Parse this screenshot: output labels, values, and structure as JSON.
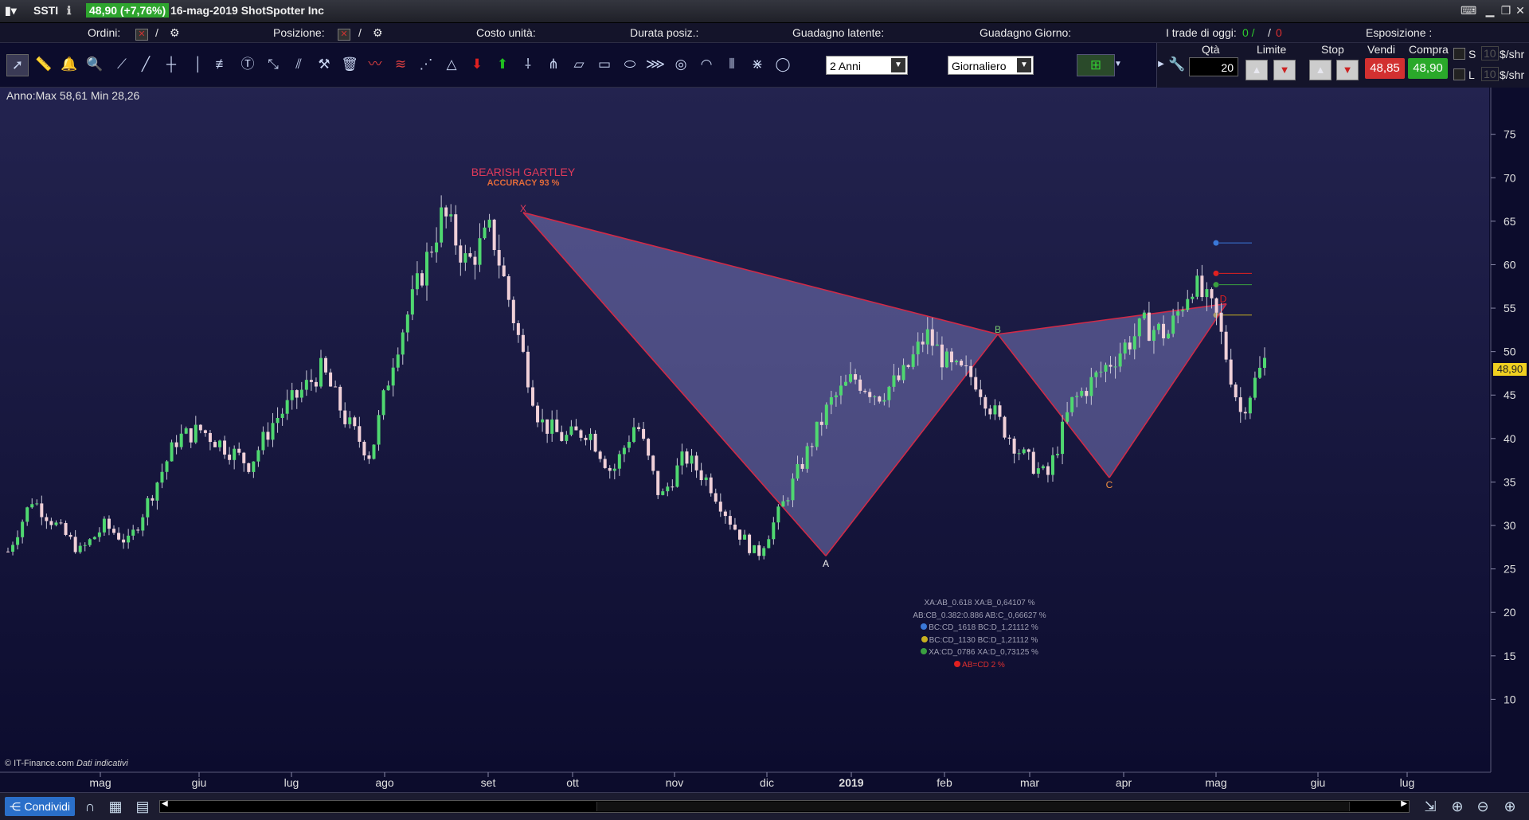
{
  "titlebar": {
    "symbol": "SSTI",
    "price_badge": "48,90 (+7,76%)",
    "date_title": "16-mag-2019 ShotSpotter Inc"
  },
  "infobar": {
    "orders_label": "Ordini:",
    "orders_sep": "/",
    "position_label": "Posizione:",
    "position_sep": "/",
    "unit_cost_label": "Costo unità:",
    "duration_label": "Durata posiz.:",
    "latent_gain_label": "Guadagno latente:",
    "day_gain_label": "Guadagno Giorno:",
    "trades_today_label": "I trade di oggi:",
    "trades_green": "0 /",
    "trades_sep": "/",
    "trades_red": "0",
    "exposure_label": "Esposizione :"
  },
  "toolbar": {
    "period_select": "2 Anni",
    "interval_select": "Giornaliero"
  },
  "trade": {
    "qty_label": "Qtà",
    "qty_value": "20",
    "limit_label": "Limite",
    "stop_label": "Stop",
    "sell_label": "Vendi",
    "buy_label": "Compra",
    "sell_price": "48,85",
    "buy_price": "48,90",
    "s_label": "S",
    "l_label": "L",
    "s_value": "10",
    "l_value": "10",
    "unit": "$/shr"
  },
  "chart": {
    "range_text": "Anno:Max 58,61 Min 28,26",
    "pattern_title": "BEARISH GARTLEY",
    "pattern_accuracy": "ACCURACY 93 %",
    "point_labels": {
      "x": "X",
      "a": "A",
      "b": "B",
      "c": "C",
      "d": "D"
    },
    "last_price_tag": "48,90",
    "copyright": "© IT-Finance.com",
    "copyright_note": "Dati indicativi",
    "ratios": [
      {
        "text": "XA:AB_0.618 XA:B_0,64107 %",
        "color": ""
      },
      {
        "text": "AB:CB_0.382:0.886 AB:C_0,66627 %",
        "color": ""
      },
      {
        "text": "BC:CD_1618 BC:D_1,21112 %",
        "color": "#3a78d8"
      },
      {
        "text": "BC:CD_1130 BC:D_1,21112 %",
        "color": "#c8b020"
      },
      {
        "text": "XA:CD_0786 XA:D_0,73125 %",
        "color": "#3aa040"
      },
      {
        "text": "AB=CD 2 %",
        "color": "#e02020"
      }
    ]
  },
  "chart_data": {
    "type": "candlestick",
    "title": "",
    "y_ticks": [
      75,
      70,
      65,
      60,
      55,
      50,
      45,
      40,
      35,
      30,
      25,
      20,
      15,
      10
    ],
    "ylim": [
      5,
      79
    ],
    "x_ticks": [
      "mag",
      "giu",
      "lug",
      "ago",
      "set",
      "ott",
      "nov",
      "dic",
      "2019",
      "feb",
      "mar",
      "apr",
      "mag",
      "giu",
      "lug"
    ],
    "pattern": {
      "X": [
        "set",
        66
      ],
      "A": [
        "dic",
        26.5
      ],
      "B": [
        "feb",
        52
      ],
      "C": [
        "mar",
        35.5
      ],
      "D": [
        "mag",
        55.5
      ]
    },
    "target_levels": [
      {
        "value": 62.5,
        "color": "#3a78d8"
      },
      {
        "value": 59,
        "color": "#e02020"
      },
      {
        "value": 57.7,
        "color": "#3aa040"
      },
      {
        "value": 54.2,
        "color": "#c8b020"
      }
    ],
    "close_path": [
      [
        "mag",
        27
      ],
      [
        "mag",
        33
      ],
      [
        "mag",
        30
      ],
      [
        "mag",
        27
      ],
      [
        "giu",
        30
      ],
      [
        "giu",
        28
      ],
      [
        "giu",
        34
      ],
      [
        "giu",
        40
      ],
      [
        "lug",
        41
      ],
      [
        "lug",
        39
      ],
      [
        "lug",
        37
      ],
      [
        "lug",
        42
      ],
      [
        "ago",
        45
      ],
      [
        "ago",
        48
      ],
      [
        "ago",
        42
      ],
      [
        "ago",
        38
      ],
      [
        "set",
        50
      ],
      [
        "set",
        58
      ],
      [
        "set",
        66
      ],
      [
        "set",
        60
      ],
      [
        "ott",
        64
      ],
      [
        "ott",
        53
      ],
      [
        "ott",
        42
      ],
      [
        "ott",
        40
      ],
      [
        "nov",
        41
      ],
      [
        "nov",
        36
      ],
      [
        "nov",
        42
      ],
      [
        "nov",
        33
      ],
      [
        "dic",
        38
      ],
      [
        "dic",
        35
      ],
      [
        "dic",
        30
      ],
      [
        "dic",
        26.5
      ],
      [
        "2019",
        32
      ],
      [
        "2019",
        38
      ],
      [
        "2019",
        44
      ],
      [
        "2019",
        47
      ],
      [
        "feb",
        45
      ],
      [
        "feb",
        47
      ],
      [
        "feb",
        52
      ],
      [
        "feb",
        48
      ],
      [
        "mar",
        47
      ],
      [
        "mar",
        42
      ],
      [
        "mar",
        38
      ],
      [
        "mar",
        35.5
      ],
      [
        "apr",
        44
      ],
      [
        "apr",
        47
      ],
      [
        "apr",
        50
      ],
      [
        "apr",
        53
      ],
      [
        "mag",
        52
      ],
      [
        "mag",
        58
      ],
      [
        "mag",
        54
      ],
      [
        "mag",
        43
      ],
      [
        "mag",
        48.9
      ]
    ]
  }
}
